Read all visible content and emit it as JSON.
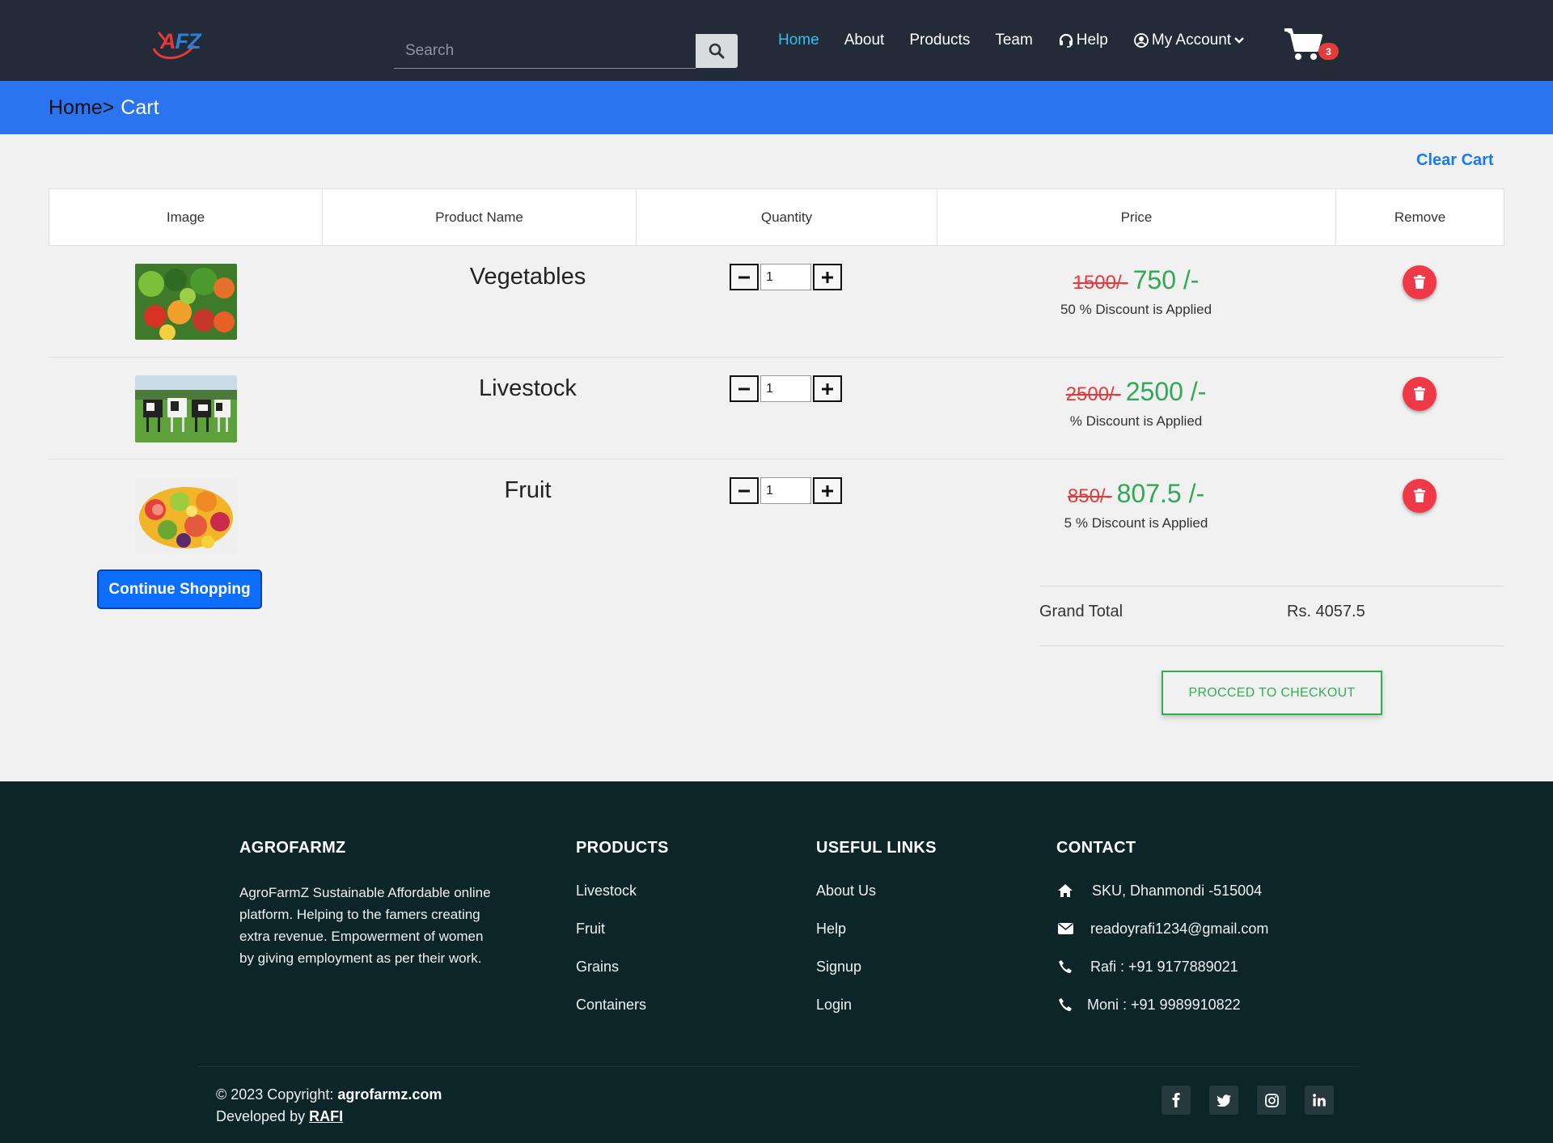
{
  "brand": {
    "logo_text": "FZ",
    "logo_accent": "A"
  },
  "search": {
    "placeholder": "Search"
  },
  "nav": {
    "items": [
      {
        "label": "Home",
        "active": true
      },
      {
        "label": "About"
      },
      {
        "label": "Products"
      },
      {
        "label": "Team"
      },
      {
        "label": "Help",
        "icon": "headset-icon"
      },
      {
        "label": "My Account",
        "icon": "user-circle-icon"
      }
    ],
    "cart_count": "3"
  },
  "breadcrumb": {
    "home": "Home>",
    "current": "Cart"
  },
  "cart": {
    "clear_label": "Clear Cart",
    "headers": [
      "Image",
      "Product Name",
      "Quantity",
      "Price",
      "Remove"
    ],
    "items": [
      {
        "name": "Vegetables",
        "qty": "1",
        "old_price": "1500/-",
        "price": "750 /-",
        "discount": "50 % Discount is Applied",
        "image": "vegetables-image"
      },
      {
        "name": "Livestock",
        "qty": "1",
        "old_price": "2500/-",
        "price": "2500 /-",
        "discount": "% Discount is Applied",
        "image": "cows-image"
      },
      {
        "name": "Fruit",
        "qty": "1",
        "old_price": "850/-",
        "price": "807.5 /-",
        "discount": "5 % Discount is Applied",
        "image": "fruit-image"
      }
    ],
    "continue_label": "Continue Shopping",
    "grand_total_label": "Grand Total",
    "grand_total_value": "Rs. 4057.5",
    "checkout_label": "PROCCED TO CHECKOUT"
  },
  "footer": {
    "about": {
      "heading": "AGROFARMZ",
      "text": "AgroFarmZ Sustainable Affordable online platform. Helping to the famers creating extra revenue. Empowerment of women by giving employment as per their work."
    },
    "products": {
      "heading": "PRODUCTS",
      "links": [
        "Livestock",
        "Fruit",
        "Grains",
        "Containers"
      ]
    },
    "useful": {
      "heading": "USEFUL LINKS",
      "links": [
        "About Us",
        "Help",
        "Signup",
        "Login"
      ]
    },
    "contact": {
      "heading": "CONTACT",
      "address": "SKU, Dhanmondi -515004",
      "email": "readoyrafi1234@gmail.com",
      "phone1": "Rafi : +91 9177889021",
      "phone2": "Moni : +91 9989910822"
    },
    "copyright_prefix": "© 2023 Copyright:",
    "copyright_site": "agrofarmz.com",
    "developed_prefix": "Developed by",
    "developer": "RAFI",
    "socials": [
      "facebook-icon",
      "twitter-icon",
      "instagram-icon",
      "linkedin-icon"
    ]
  },
  "colors": {
    "navbar": "#232b38",
    "accent_blue": "#2a74ef",
    "active_link": "#2ec0ef",
    "price_green": "#30a955",
    "old_price_red": "#e63a3a",
    "remove_red": "#ef3947",
    "footer_bg": "#0b2529"
  }
}
